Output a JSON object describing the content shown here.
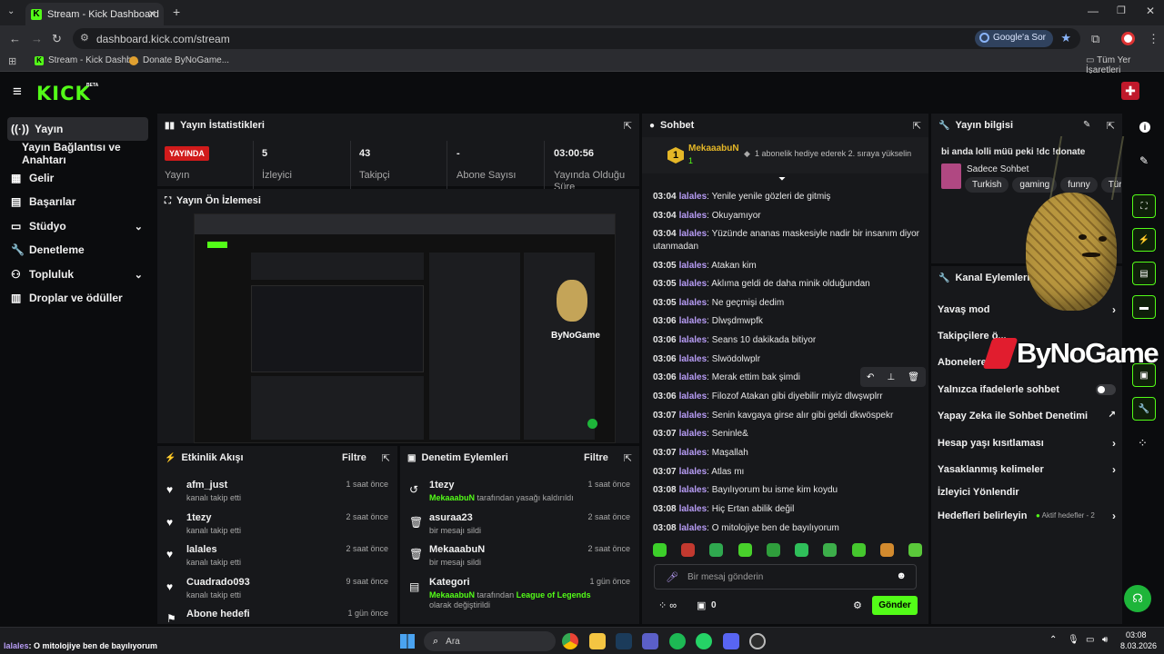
{
  "browser": {
    "tab_title": "Stream - Kick Dashboard",
    "url": "dashboard.kick.com/stream",
    "ask_google": "Google'a Sor",
    "bookmarks": [
      {
        "label": "Stream - Kick Dashb..."
      },
      {
        "label": "Donate ByNoGame..."
      }
    ],
    "all_bookmarks": "Tüm Yer İşaretleri"
  },
  "kick": {
    "logo": "KICK",
    "beta": "BETA"
  },
  "sidebar": {
    "items": [
      {
        "label": "Yayın",
        "icon": "broadcast-icon"
      },
      {
        "label": "Yayın Bağlantısı ve Anahtarı",
        "icon": ""
      },
      {
        "label": "Gelir",
        "icon": "revenue-icon"
      },
      {
        "label": "Başarılar",
        "icon": "achievements-icon"
      },
      {
        "label": "Stüdyo",
        "icon": "studio-icon"
      },
      {
        "label": "Denetleme",
        "icon": "wrench-icon"
      },
      {
        "label": "Topluluk",
        "icon": "community-icon"
      },
      {
        "label": "Droplar ve ödüller",
        "icon": "drops-icon"
      }
    ]
  },
  "stats": {
    "title": "Yayın İstatistikleri",
    "live_badge": "YAYINDA",
    "live_label": "Yayın",
    "viewers": "5",
    "viewers_label": "İzleyici",
    "followers": "43",
    "followers_label": "Takipçi",
    "subs": "-",
    "subs_label": "Abone Sayısı",
    "uptime": "03:00:56",
    "uptime_label": "Yayında Olduğu Süre"
  },
  "preview": {
    "title": "Yayın Ön İzlemesi"
  },
  "activity": {
    "title": "Etkinlik Akışı",
    "filter": "Filtre",
    "rows": [
      {
        "name": "afm_just",
        "sub": "kanalı takip etti",
        "time": "1 saat önce"
      },
      {
        "name": "1tezy",
        "sub": "kanalı takip etti",
        "time": "2 saat önce"
      },
      {
        "name": "lalales",
        "sub": "kanalı takip etti",
        "time": "2 saat önce"
      },
      {
        "name": "Cuadrado093",
        "sub": "kanalı takip etti",
        "time": "9 saat önce"
      },
      {
        "name": "Abone hedefi",
        "sub": "",
        "time": "1 gün önce"
      }
    ]
  },
  "moderation": {
    "title": "Denetim Eylemleri",
    "filter": "Filtre",
    "rows": [
      {
        "name": "1tezy",
        "actor": "MekaaabuN",
        "sub": "tarafından yasağı kaldırıldı",
        "time": "1 saat önce"
      },
      {
        "name": "asuraa23",
        "actor": "",
        "sub": "bir mesajı sildi",
        "time": "2 saat önce"
      },
      {
        "name": "MekaaabuN",
        "actor": "",
        "sub": "bir mesajı sildi",
        "time": "2 saat önce"
      },
      {
        "name": "Kategori",
        "actor": "MekaaabuN",
        "sub": "tarafından",
        "extra": "League of Legends",
        "sub2": "olarak değiştirildi",
        "time": "1 gün önce"
      }
    ]
  },
  "chat": {
    "title": "Sohbet",
    "pinned_user": "MekaaabuN",
    "pinned_count": "1",
    "pinned_text": "1 abonelik hediye ederek 2. sıraya yükselin",
    "messages": [
      {
        "time": "03:04",
        "user": "lalales",
        "text": "Yenile yenile gözleri de gitmiş"
      },
      {
        "time": "03:04",
        "user": "lalales",
        "text": "Okuyamıyor"
      },
      {
        "time": "03:04",
        "user": "lalales",
        "text": "Yüzünde ananas maskesiyle nadir bir insanım diyor utanmadan"
      },
      {
        "time": "03:05",
        "user": "lalales",
        "text": "Atakan kim"
      },
      {
        "time": "03:05",
        "user": "lalales",
        "text": "Aklıma geldi de daha minik olduğundan"
      },
      {
        "time": "03:05",
        "user": "lalales",
        "text": "Ne geçmişi dedim"
      },
      {
        "time": "03:06",
        "user": "lalales",
        "text": "Dlwşdmwpfk"
      },
      {
        "time": "03:06",
        "user": "lalales",
        "text": "Seans 10 dakikada bitiyor"
      },
      {
        "time": "03:06",
        "user": "lalales",
        "text": "Slwödolwplr"
      },
      {
        "time": "03:06",
        "user": "lalales",
        "text": "Merak ettim bak şimdi"
      },
      {
        "time": "03:06",
        "user": "lalales",
        "text": "Filozof Atakan gibi diyebilir miyiz dlwşwplrr"
      },
      {
        "time": "03:07",
        "user": "lalales",
        "text": "Senin kavgaya girse alır gibi geldi dkwöspekr"
      },
      {
        "time": "03:07",
        "user": "lalales",
        "text": "Seninle&"
      },
      {
        "time": "03:07",
        "user": "lalales",
        "text": "Maşallah"
      },
      {
        "time": "03:07",
        "user": "lalales",
        "text": "Atlas mı"
      },
      {
        "time": "03:08",
        "user": "lalales",
        "text": "Bayılıyorum bu isme kim koydu"
      },
      {
        "time": "03:08",
        "user": "lalales",
        "text": "Hiç Ertan abilik değil"
      },
      {
        "time": "03:08",
        "user": "lalales",
        "text": "O mitolojiye ben de bayılıyorum"
      }
    ],
    "input_placeholder": "Bir mesaj gönderin",
    "points": "0",
    "send": "Gönder"
  },
  "stream_info": {
    "title": "Yayın bilgisi",
    "stream_title": "bi anda lolli müü peki !dc !donate",
    "mode": "Sadece Sohbet",
    "tags": [
      "Turkish",
      "gaming",
      "funny",
      "Türk"
    ]
  },
  "channel_actions": {
    "title": "Kanal Eylemleri",
    "items": [
      {
        "label": "Yavaş mod"
      },
      {
        "label": "Takipçilere ö..."
      },
      {
        "label": "Abonelere ö..."
      },
      {
        "label": "Yalnızca ifadelerle sohbet"
      },
      {
        "label": "Yapay Zeka ile Sohbet Denetimi"
      },
      {
        "label": "Hesap yaşı kısıtlaması"
      },
      {
        "label": "Yasaklanmış kelimeler"
      },
      {
        "label": "İzleyici Yönlendir"
      },
      {
        "label": "Hedefleri belirleyin"
      }
    ],
    "goals_status": "Aktif hedefler - 2"
  },
  "overlay": {
    "brand": "ByNoGame"
  },
  "ticker": {
    "user": "lalales",
    "text": ": O mitolojiye ben de bayılıyorum"
  },
  "taskbar": {
    "search": "Ara",
    "time": "03:08",
    "date": "8.03.2026"
  },
  "colors": {
    "kick_green": "#53fc18",
    "username": "#b79cf5",
    "live_red": "#d11b1b"
  }
}
